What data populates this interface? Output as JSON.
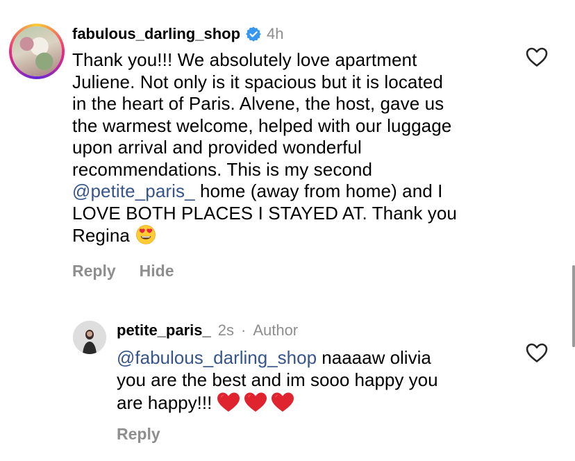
{
  "comment": {
    "username": "fabulous_darling_shop",
    "time": "4h",
    "text_line1": "Thank you!!! We absolutely love apartment",
    "text_line2": "Juliene. Not only is it spacious but it is located",
    "text_line3": "in the heart of Paris. Alvene, the host, gave us",
    "text_line4": "the warmest welcome, helped with our luggage",
    "text_line5": "upon arrival and provided wonderful",
    "text_line6": "recommendations. This is my second",
    "mention": "@petite_paris_",
    "text_line7_rest": " home (away from home) and I",
    "text_line8": "LOVE BOTH PLACES I STAYED AT. Thank you",
    "text_line9": "Regina",
    "reply_label": "Reply",
    "hide_label": "Hide"
  },
  "reply": {
    "username": "petite_paris_",
    "time": "2s",
    "separator": "·",
    "author_label": "Author",
    "mention": "@fabulous_darling_shop",
    "text_line1_rest": " naaaaw olivia",
    "text_line2": "you are the best and im sooo happy you",
    "text_line3": "are happy!!!",
    "reply_label": "Reply"
  },
  "icons": {
    "like": "heart-outline-icon",
    "verified": "verified-badge-icon",
    "emoji1": "heart-eyes-emoji",
    "emoji2": "red-heart-emoji"
  },
  "colors": {
    "mention": "#37558c",
    "muted": "#8e8e8e",
    "verified": "#3897f0"
  }
}
